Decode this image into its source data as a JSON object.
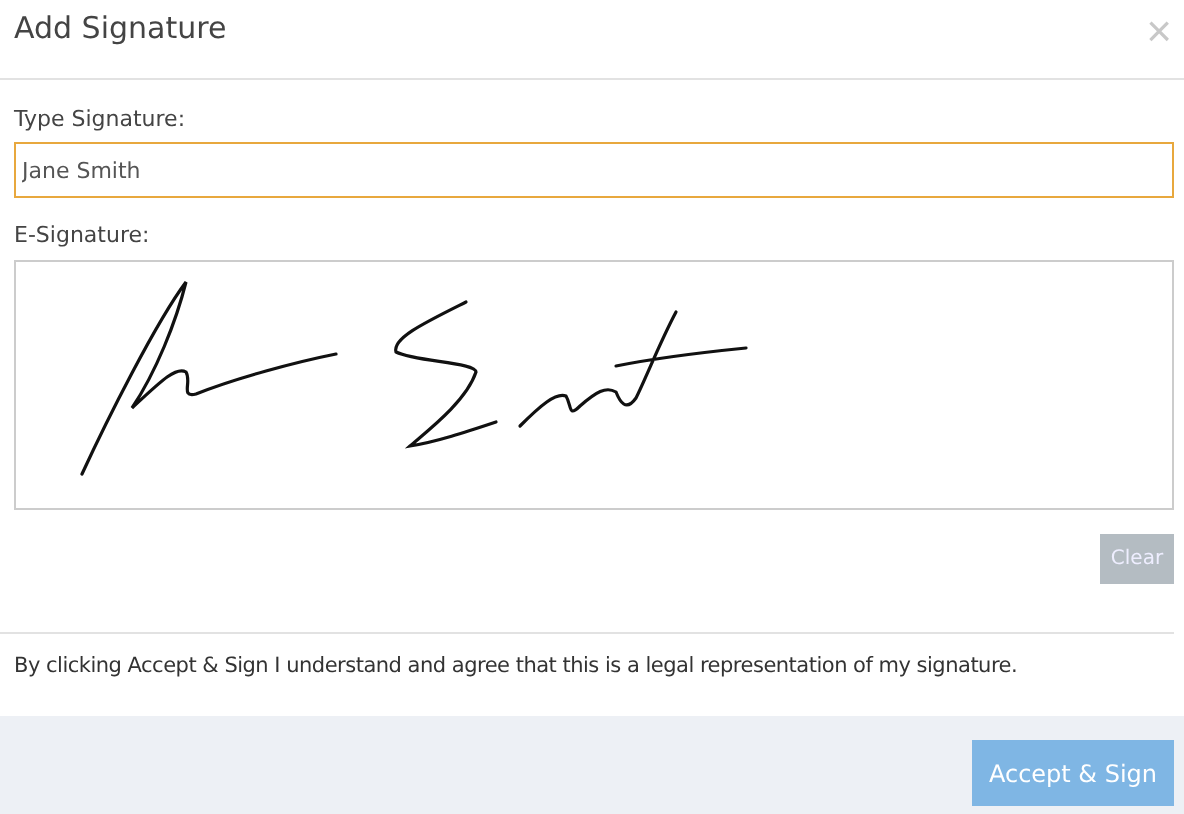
{
  "dialog": {
    "title": "Add Signature",
    "close": "×"
  },
  "type_signature": {
    "label": "Type Signature:",
    "value": "Jane Smith",
    "focused": true
  },
  "e_signature": {
    "label": "E-Signature:"
  },
  "clear_button": "Clear",
  "notice": "By clicking Accept & Sign I understand and agree that this is a legal representation of my signature.",
  "accept_button": "Accept & Sign"
}
